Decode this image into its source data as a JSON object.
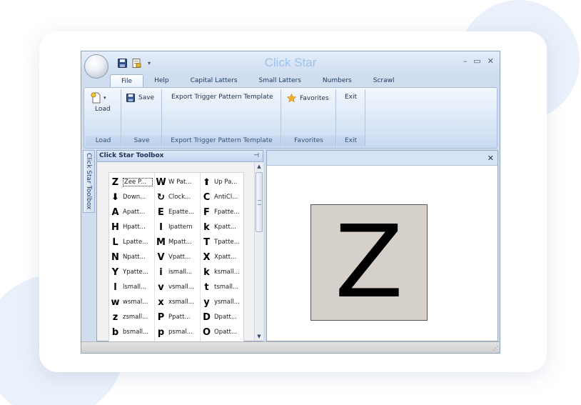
{
  "app_title": "Click Star",
  "window_controls": {
    "minimize": "–",
    "maximize": "▭",
    "close": "✕"
  },
  "qat": {
    "dropdown": "▾"
  },
  "tabs": [
    {
      "label": "File",
      "active": true
    },
    {
      "label": "Help"
    },
    {
      "label": "Capital Latters"
    },
    {
      "label": "Small Latters"
    },
    {
      "label": "Numbers"
    },
    {
      "label": "Scrawl"
    }
  ],
  "ribbon": {
    "load": {
      "label": "Load",
      "caption": "Load"
    },
    "save": {
      "label": "Save",
      "caption": "Save"
    },
    "export": {
      "label": "Export Trigger Pattern Template",
      "caption": "Export Trigger Pattern Template"
    },
    "favorites": {
      "label": "Favorites",
      "caption": "Favorites"
    },
    "exit": {
      "label": "Exit",
      "caption": "Exit"
    }
  },
  "toolbox": {
    "side_tab": "Click Star Toolbox",
    "title": "Click Star Toolbox",
    "pin": "⊣",
    "columns": [
      [
        {
          "glyph": "Z",
          "label": "Zee P...",
          "selected": true
        },
        {
          "glyph": "⬇",
          "label": "Down..."
        },
        {
          "glyph": "A",
          "label": "Apatt..."
        },
        {
          "glyph": "H",
          "label": "Hpatt..."
        },
        {
          "glyph": "L",
          "label": "Lpatte..."
        },
        {
          "glyph": "N",
          "label": "Npatt..."
        },
        {
          "glyph": "Y",
          "label": "Ypatte..."
        },
        {
          "glyph": "l",
          "label": "lsmall..."
        },
        {
          "glyph": "w",
          "label": "wsmal..."
        },
        {
          "glyph": "z",
          "label": "zsmall..."
        },
        {
          "glyph": "b",
          "label": "bsmall..."
        }
      ],
      [
        {
          "glyph": "W",
          "label": "W Pat..."
        },
        {
          "glyph": "↻",
          "label": "Clock..."
        },
        {
          "glyph": "E",
          "label": "Epatte..."
        },
        {
          "glyph": "I",
          "label": "Ipattern"
        },
        {
          "glyph": "M",
          "label": "Mpatt..."
        },
        {
          "glyph": "V",
          "label": "Vpatt..."
        },
        {
          "glyph": "i",
          "label": "ismall..."
        },
        {
          "glyph": "v",
          "label": "vsmall..."
        },
        {
          "glyph": "x",
          "label": "xsmall..."
        },
        {
          "glyph": "P",
          "label": "Ppatt..."
        },
        {
          "glyph": "p",
          "label": "psmal..."
        }
      ],
      [
        {
          "glyph": "⬆",
          "label": "Up Pa..."
        },
        {
          "glyph": "C",
          "label": "AntiCl..."
        },
        {
          "glyph": "F",
          "label": "Fpatte..."
        },
        {
          "glyph": "k",
          "label": "Kpatt..."
        },
        {
          "glyph": "T",
          "label": "Tpatte..."
        },
        {
          "glyph": "X",
          "label": "Xpatt..."
        },
        {
          "glyph": "k",
          "label": "ksmall..."
        },
        {
          "glyph": "t",
          "label": "tsmall..."
        },
        {
          "glyph": "y",
          "label": "ysmall..."
        },
        {
          "glyph": "D",
          "label": "Dpatt..."
        },
        {
          "glyph": "O",
          "label": "Opatt..."
        }
      ]
    ]
  },
  "document": {
    "close": "✕",
    "preview_letter": "Z"
  },
  "statusbar": {
    "grip": "⋰"
  },
  "colors": {
    "title": "#9dc3ea",
    "ribbon": "#d9e6f6",
    "preview_bg": "#d5d0c9",
    "frame": "#cfddee"
  }
}
